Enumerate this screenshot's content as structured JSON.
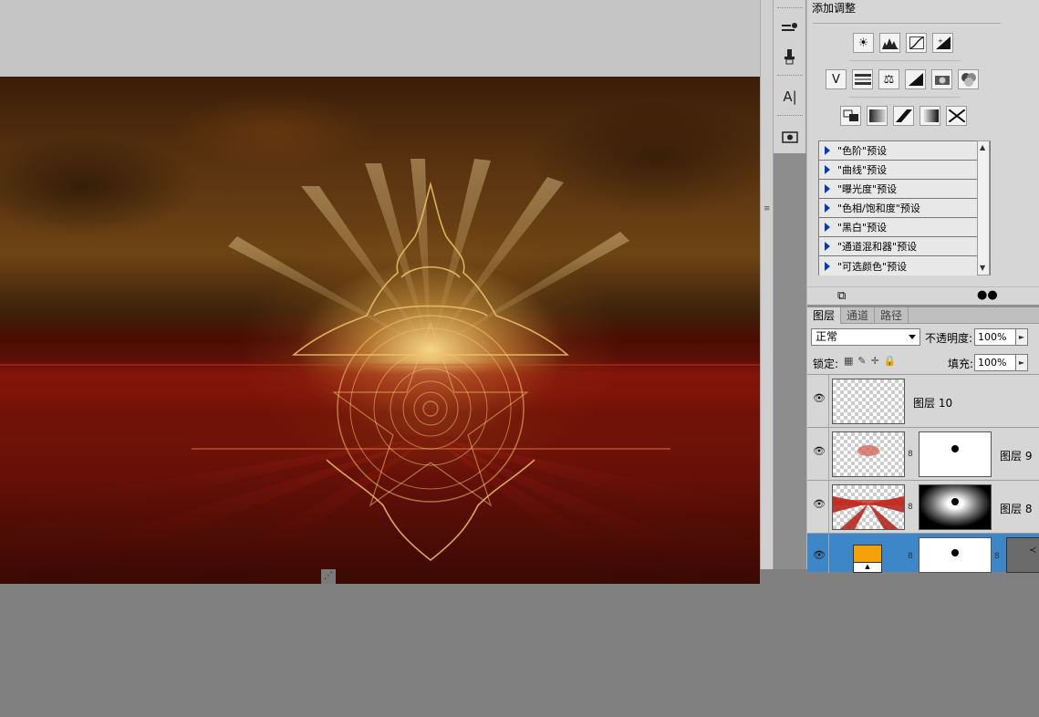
{
  "adjustments": {
    "title": "添加调整",
    "icons_row1": [
      "brightness-icon",
      "levels-icon",
      "curves-icon",
      "exposure-icon"
    ],
    "icons_row2": [
      "vibrance-icon",
      "hue-saturation-icon",
      "color-balance-icon",
      "black-white-icon",
      "photo-filter-icon",
      "channel-mixer-icon"
    ],
    "icons_row3": [
      "invert-icon",
      "posterize-icon",
      "threshold-icon",
      "gradient-map-icon",
      "selective-color-icon"
    ],
    "presets": [
      "\"色阶\"预设",
      "\"曲线\"预设",
      "\"曝光度\"预设",
      "\"色相/饱和度\"预设",
      "\"黑白\"预设",
      "\"通道混和器\"预设",
      "\"可选颜色\"预设"
    ]
  },
  "layers_panel": {
    "tabs": [
      "图层",
      "通道",
      "路径"
    ],
    "blend_mode": "正常",
    "opacity_label": "不透明度:",
    "opacity_value": "100%",
    "lock_label": "锁定:",
    "fill_label": "填充:",
    "fill_value": "100%",
    "layers": [
      {
        "name": "图层 10",
        "has_mask": false,
        "selected": false
      },
      {
        "name": "图层 9",
        "has_mask": true,
        "selected": false
      },
      {
        "name": "图层 8",
        "has_mask": true,
        "selected": false
      },
      {
        "name": "",
        "has_mask": true,
        "selected": true
      }
    ]
  },
  "colors": {
    "selection": "#3d86c8",
    "adjustment_fill": "#f5a20a"
  }
}
